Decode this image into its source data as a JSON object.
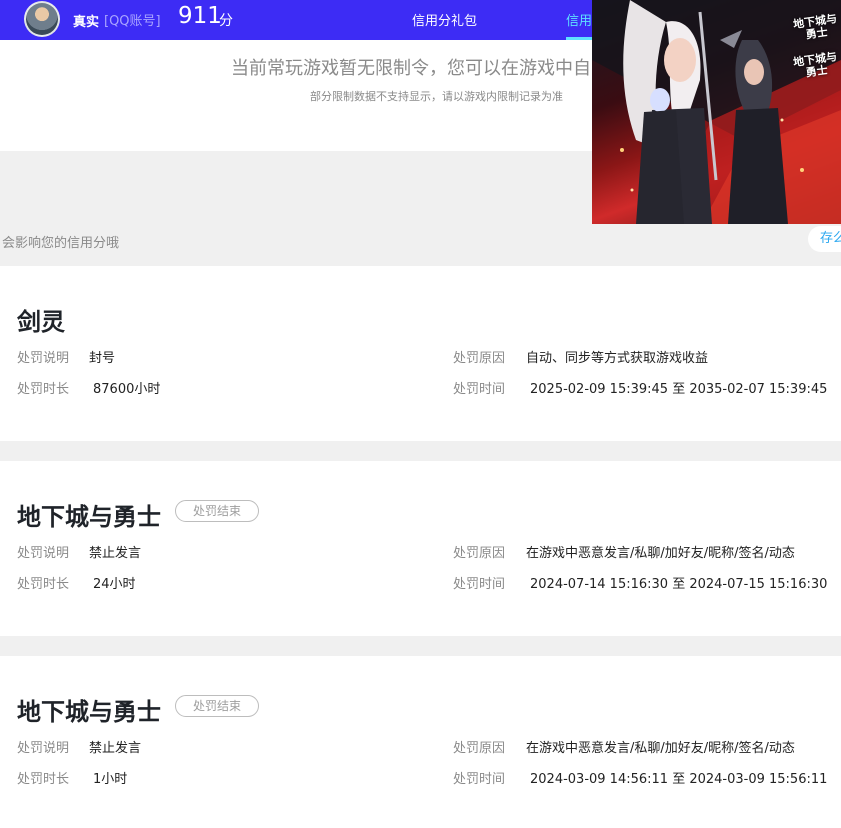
{
  "header": {
    "user_name": "真实",
    "account_type": "[QQ账号]",
    "score": "911",
    "score_unit": "分",
    "nav_gift": "信用分礼包",
    "nav_credit": "信用",
    "accent_color": "#3d2cf5",
    "active_color": "#5fe0ff"
  },
  "notice": {
    "main": "当前常玩游戏暂无限制令，您可以在游戏中自",
    "sub": "部分限制数据不支持显示，请以游戏内限制记录为准"
  },
  "section": {
    "impact_text": "会影响您的信用分哦",
    "save_label": "存么"
  },
  "ad": {
    "logo_text": "地下城与勇士",
    "logo_text_2": "地下城与勇士"
  },
  "labels": {
    "desc": "处罚说明",
    "duration": "处罚时长",
    "reason": "处罚原因",
    "time": "处罚时间"
  },
  "records": [
    {
      "game": "剑灵",
      "status": "",
      "desc": "封号",
      "duration": "87600小时",
      "reason": "自动、同步等方式获取游戏收益",
      "time": "2025-02-09 15:39:45 至 2035-02-07 15:39:45"
    },
    {
      "game": "地下城与勇士",
      "status": "处罚结束",
      "desc": "禁止发言",
      "duration": "24小时",
      "reason": "在游戏中恶意发言/私聊/加好友/昵称/签名/动态",
      "time": "2024-07-14 15:16:30 至 2024-07-15 15:16:30"
    },
    {
      "game": "地下城与勇士",
      "status": "处罚结束",
      "desc": "禁止发言",
      "duration": "1小时",
      "reason": "在游戏中恶意发言/私聊/加好友/昵称/签名/动态",
      "time": "2024-03-09 14:56:11 至 2024-03-09 15:56:11"
    }
  ]
}
